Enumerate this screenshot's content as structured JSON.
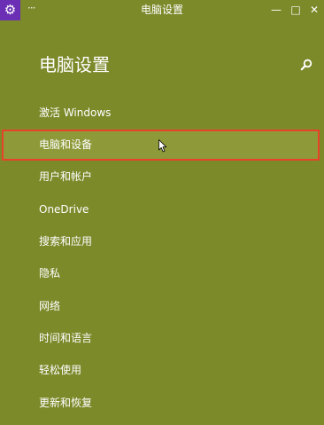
{
  "window": {
    "title": "电脑设置",
    "app_icon": "gear-icon",
    "controls": {
      "minimize": "—",
      "maximize": "□",
      "close": "✕"
    }
  },
  "main": {
    "title": "电脑设置",
    "search_icon": "search-icon",
    "menu": [
      {
        "label": "激活 Windows"
      },
      {
        "label": "电脑和设备",
        "selected": true
      },
      {
        "label": "用户和帐户"
      },
      {
        "label": "OneDrive"
      },
      {
        "label": "搜索和应用"
      },
      {
        "label": "隐私"
      },
      {
        "label": "网络"
      },
      {
        "label": "时间和语言"
      },
      {
        "label": "轻松使用"
      },
      {
        "label": "更新和恢复"
      }
    ]
  },
  "colors": {
    "background": "#7c8a2a",
    "selected_border": "#e8432a",
    "app_icon_bg": "#6a2fb4"
  }
}
